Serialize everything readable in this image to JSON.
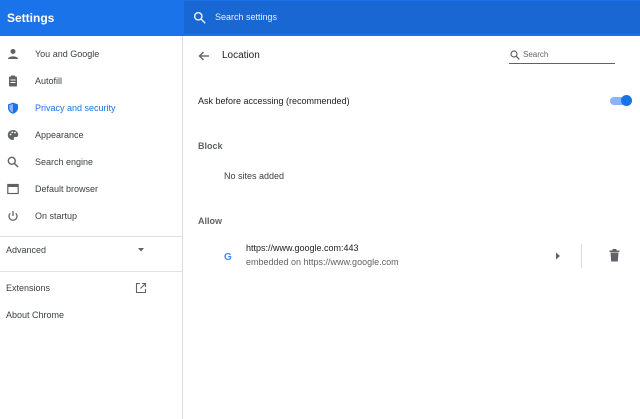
{
  "topbar": {
    "title": "Settings",
    "search_placeholder": "Search settings"
  },
  "sidebar": {
    "items": [
      {
        "label": "You and Google",
        "icon": "person-icon"
      },
      {
        "label": "Autofill",
        "icon": "clipboard-icon"
      },
      {
        "label": "Privacy and security",
        "icon": "shield-icon",
        "active": true
      },
      {
        "label": "Appearance",
        "icon": "palette-icon"
      },
      {
        "label": "Search engine",
        "icon": "search-icon"
      },
      {
        "label": "Default browser",
        "icon": "browser-icon"
      },
      {
        "label": "On startup",
        "icon": "power-icon"
      }
    ],
    "advanced_label": "Advanced",
    "extensions_label": "Extensions",
    "about_label": "About Chrome"
  },
  "content": {
    "page_title": "Location",
    "search_placeholder": "Search",
    "ask_label": "Ask before accessing (recommended)",
    "ask_enabled": true,
    "block_label": "Block",
    "block_empty": "No sites added",
    "allow_label": "Allow",
    "allow_sites": [
      {
        "url": "https://www.google.com:443",
        "subtitle": "embedded on https://www.google.com",
        "icon_letter": "G"
      }
    ]
  },
  "colors": {
    "accent": "#1a73e8",
    "header": "#1a73e8",
    "search_bar": "#1967d2"
  }
}
